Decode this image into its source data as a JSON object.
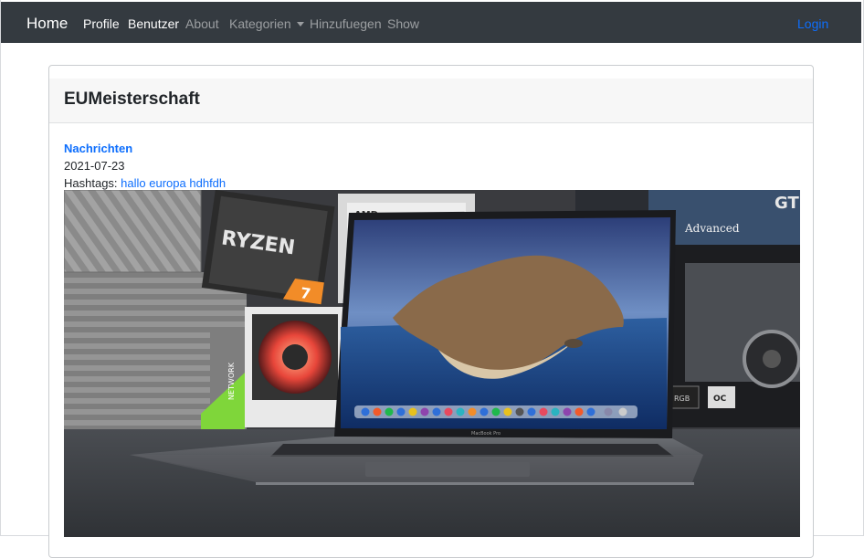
{
  "navbar": {
    "brand": "Home",
    "links": [
      "Profile",
      "Benutzer",
      "About",
      "Kategorien",
      "Hinzufuegen",
      "Show"
    ],
    "login": "Login"
  },
  "post": {
    "title": "EUMeisterschaft",
    "category": "Nachrichten",
    "date": "2021-07-23",
    "hashtags_label": "Hashtags:",
    "hashtags": [
      "hallo",
      "europa",
      "hdhfdh"
    ]
  },
  "photo": {
    "alt": "MacBook Pro with Ryzen and GPU boxes",
    "text": {
      "box_left": "RYZEN",
      "box_left_number": "7",
      "box_top": "AMD",
      "box_right": "GT",
      "box_right_sub": "Advanced",
      "rgb": "RGB",
      "oc": "OC",
      "side_text": "NETWORK",
      "laptop_label": "MacBook Pro"
    }
  },
  "colors": {
    "navbar_bg": "#343a40",
    "link": "#0d6efd",
    "header_bg": "#f7f7f7"
  }
}
